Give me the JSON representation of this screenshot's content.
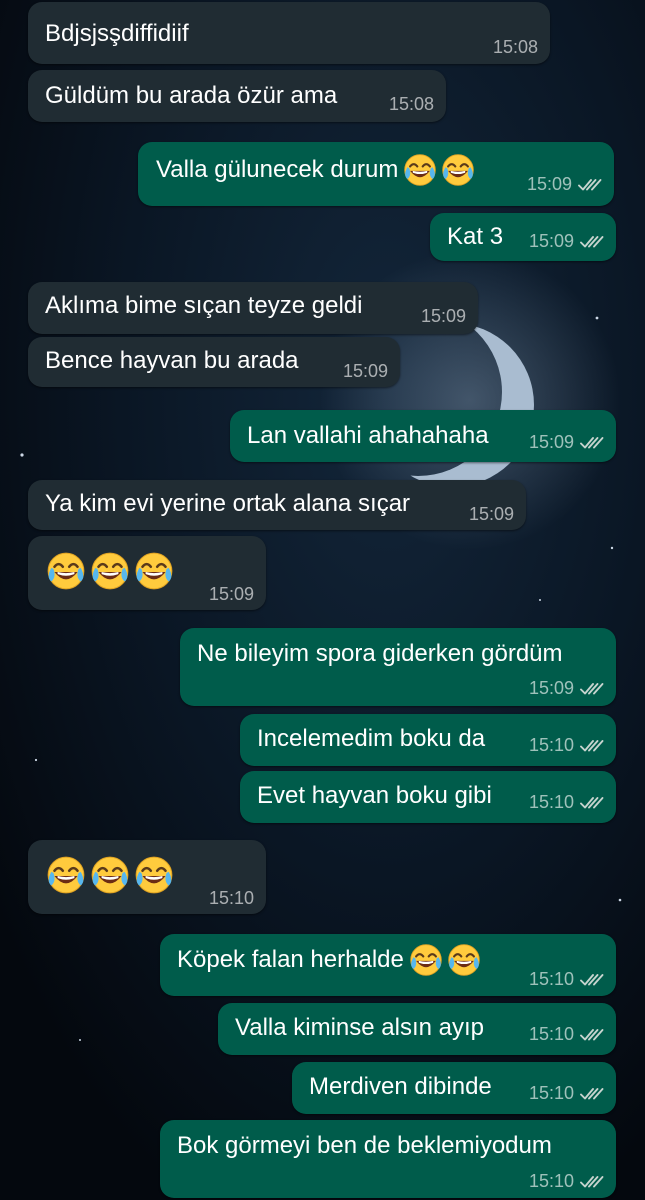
{
  "chat": {
    "colors": {
      "incoming_bubble": "#202c33",
      "outgoing_bubble": "#005c4b",
      "read_ticks": "#c7d4cf",
      "time_text": "#a9b3b0",
      "wallpaper": "#060c14"
    },
    "messages": [
      {
        "direction": "in",
        "text": "Bdjsjsşdiffidiif",
        "time": "15:08"
      },
      {
        "direction": "in",
        "text": "Güldüm bu arada özür ama",
        "time": "15:08"
      },
      {
        "direction": "out",
        "text": "Valla gülunecek durum",
        "emojis": [
          "face-with-tears-of-joy",
          "face-with-tears-of-joy"
        ],
        "time": "15:09",
        "status": "read"
      },
      {
        "direction": "out",
        "text": "Kat 3",
        "time": "15:09",
        "status": "read"
      },
      {
        "direction": "in",
        "text": "Aklıma bime sıçan teyze geldi",
        "time": "15:09"
      },
      {
        "direction": "in",
        "text": "Bence hayvan bu arada",
        "time": "15:09"
      },
      {
        "direction": "out",
        "text": "Lan vallahi ahahahaha",
        "time": "15:09",
        "status": "read"
      },
      {
        "direction": "in",
        "text": "Ya kim evi yerine ortak alana sıçar",
        "time": "15:09"
      },
      {
        "direction": "in",
        "emojis": [
          "face-with-tears-of-joy",
          "face-with-tears-of-joy",
          "face-with-tears-of-joy"
        ],
        "time": "15:09"
      },
      {
        "direction": "out",
        "text": "Ne bileyim spora giderken gördüm",
        "time": "15:09",
        "status": "read"
      },
      {
        "direction": "out",
        "text": "Incelemedim boku da",
        "time": "15:10",
        "status": "read"
      },
      {
        "direction": "out",
        "text": "Evet hayvan boku gibi",
        "time": "15:10",
        "status": "read"
      },
      {
        "direction": "in",
        "emojis": [
          "face-with-tears-of-joy",
          "face-with-tears-of-joy",
          "face-with-tears-of-joy"
        ],
        "time": "15:10"
      },
      {
        "direction": "out",
        "text": "Köpek falan herhalde",
        "emojis": [
          "face-with-tears-of-joy",
          "face-with-tears-of-joy"
        ],
        "time": "15:10",
        "status": "read"
      },
      {
        "direction": "out",
        "text": "Valla kiminse alsın ayıp",
        "time": "15:10",
        "status": "read"
      },
      {
        "direction": "out",
        "text": "Merdiven dibinde",
        "time": "15:10",
        "status": "read"
      },
      {
        "direction": "out",
        "text": "Bok görmeyi ben de beklemiyodum",
        "time": "15:10",
        "status": "read"
      }
    ]
  }
}
